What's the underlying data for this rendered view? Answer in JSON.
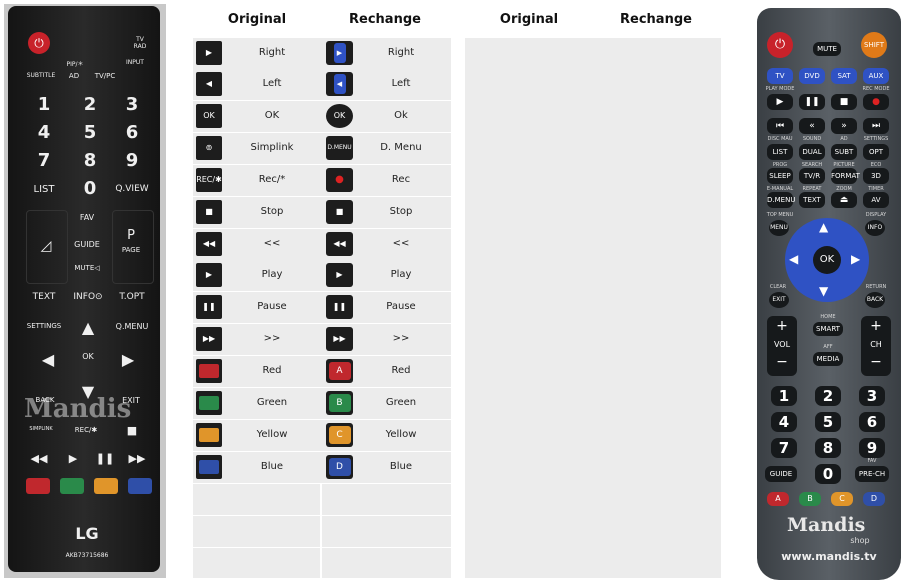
{
  "headers": {
    "original": "Original",
    "rechange": "Rechange"
  },
  "rows": [
    {
      "orig_label": "Right",
      "rep_label": "Right",
      "orig_icon": "right-arrow",
      "rep_icon": "blue-right-arrow"
    },
    {
      "orig_label": "Left",
      "rep_label": "Left",
      "orig_icon": "left-arrow",
      "rep_icon": "blue-left-arrow"
    },
    {
      "orig_label": "OK",
      "rep_label": "Ok",
      "orig_icon": "ok",
      "rep_icon": "ok-round"
    },
    {
      "orig_label": "Simplink",
      "rep_label": "D. Menu",
      "orig_icon": "simplink",
      "rep_icon": "dmenu"
    },
    {
      "orig_label": "Rec/*",
      "rep_label": "Rec",
      "orig_icon": "rec-star",
      "rep_icon": "rec-red-dot"
    },
    {
      "orig_label": "Stop",
      "rep_label": "Stop",
      "orig_icon": "stop",
      "rep_icon": "stop"
    },
    {
      "orig_label": "<<",
      "rep_label": "<<",
      "orig_icon": "rewind",
      "rep_icon": "rewind"
    },
    {
      "orig_label": "Play",
      "rep_label": "Play",
      "orig_icon": "play",
      "rep_icon": "play"
    },
    {
      "orig_label": "Pause",
      "rep_label": "Pause",
      "orig_icon": "pause",
      "rep_icon": "pause"
    },
    {
      "orig_label": ">>",
      "rep_label": ">>",
      "orig_icon": "fast-forward",
      "rep_icon": "fast-forward"
    },
    {
      "orig_label": "Red",
      "rep_label": "Red",
      "orig_icon": "red",
      "rep_icon": "red-A",
      "color": "#c0282d",
      "letter": "A"
    },
    {
      "orig_label": "Green",
      "rep_label": "Green",
      "orig_icon": "green",
      "rep_icon": "green-B",
      "color": "#2a8a4a",
      "letter": "B"
    },
    {
      "orig_label": "Yellow",
      "rep_label": "Yellow",
      "orig_icon": "yellow",
      "rep_icon": "yellow-C",
      "color": "#e0952a",
      "letter": "C"
    },
    {
      "orig_label": "Blue",
      "rep_label": "Blue",
      "orig_icon": "blue",
      "rep_icon": "blue-D",
      "color": "#2f4fa8",
      "letter": "D"
    }
  ],
  "remote_original": {
    "labels": {
      "tvrad": "TV\nRAD",
      "pip": "PIP/＊",
      "subtitle": "SUBTITLE",
      "ad": "AD",
      "tvpc": "TV/PC",
      "input": "INPUT",
      "list": "LIST",
      "qview": "Q.VIEW",
      "fav": "FAV",
      "guide": "GUIDE",
      "page": "PAGE",
      "p": "P",
      "mute": "MUTE◁",
      "text": "TEXT",
      "info": "INFO⊙",
      "topt": "T.OPT",
      "settings": "SETTINGS",
      "qmenu": "Q.MENU",
      "ok": "OK",
      "back": "BACK",
      "exit": "EXIT",
      "simplink": "SIMPLINK",
      "rec": "REC/✱",
      "lg": "LG",
      "model": "AKB73715686",
      "watermark": "Mandis"
    },
    "numbers": [
      "1",
      "2",
      "3",
      "4",
      "5",
      "6",
      "7",
      "8",
      "9",
      "0"
    ]
  },
  "remote_new": {
    "labels": {
      "shift": "SHIFT",
      "mute": "MUTE",
      "tv": "TV",
      "dvd": "DVD",
      "sat": "SAT",
      "aux": "AUX",
      "playmode": "PLAY MODE",
      "recmode": "REC MODE",
      "discmau": "DISC MAU",
      "sound": "SOUND",
      "ad": "AD",
      "settings": "SETTINGS",
      "list": "LIST",
      "dual": "DUAL",
      "subt": "SUBT",
      "opt": "OPT",
      "prog": "PROG",
      "search": "SEARCH",
      "picture": "PICTURE",
      "eco": "ECO",
      "sleep": "SLEEP",
      "tvr": "TV/R",
      "format": "FORMAT",
      "3d": "3D",
      "emanual": "E-MANUAL",
      "repeat": "REPEAT",
      "zoom": "ZOOM",
      "timer": "TIMER",
      "dmenu": "D.MENU",
      "text": "TEXT",
      "av": "AV",
      "topmenu": "TOP MENU",
      "display": "DISPLAY",
      "menu": "MENU",
      "info": "INFO",
      "ok": "OK",
      "clear": "CLEAR",
      "return": "RETURN",
      "exit": "EXIT",
      "back": "BACK",
      "home": "HOME",
      "smart": "SMART",
      "aff": "AFF",
      "media": "MEDIA",
      "vol": "VOL",
      "ch": "CH",
      "guide": "GUIDE",
      "prech": "PRE-CH",
      "fav": "FAV",
      "A": "A",
      "B": "B",
      "C": "C",
      "D": "D",
      "mandis": "Mandis",
      "shop": "shop",
      "url": "www.mandis.tv"
    },
    "numbers": [
      "1",
      "2",
      "3",
      "4",
      "5",
      "6",
      "7",
      "8",
      "9",
      "0"
    ]
  }
}
